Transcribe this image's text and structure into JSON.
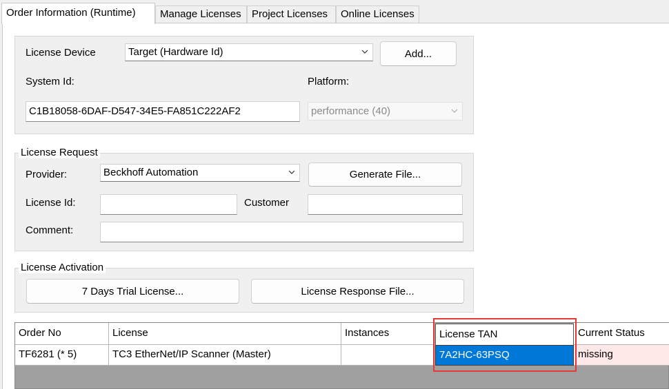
{
  "tabs": [
    {
      "label": "Order Information (Runtime)",
      "active": true
    },
    {
      "label": "Manage Licenses",
      "active": false
    },
    {
      "label": "Project Licenses",
      "active": false
    },
    {
      "label": "Online Licenses",
      "active": false
    }
  ],
  "license_device": {
    "label": "License Device",
    "selected": "Target (Hardware Id)",
    "add_button": "Add...",
    "system_id_label": "System Id:",
    "system_id_value": "C1B18058-6DAF-D547-34E5-FA851C222AF2",
    "platform_label": "Platform:",
    "platform_value": "performance (40)"
  },
  "license_request": {
    "legend": "License Request",
    "provider_label": "Provider:",
    "provider_value": "Beckhoff Automation",
    "generate_button": "Generate File...",
    "license_id_label": "License Id:",
    "license_id_value": "",
    "customer_label": "Customer",
    "customer_value": "",
    "comment_label": "Comment:",
    "comment_value": ""
  },
  "license_activation": {
    "legend": "License Activation",
    "trial_button": "7 Days Trial License...",
    "response_button": "License Response File..."
  },
  "table": {
    "columns": [
      "Order No",
      "License",
      "Instances",
      "License TAN",
      "Current Status"
    ],
    "rows": [
      {
        "order_no": "TF6281 (* 5)",
        "license": "TC3 EtherNet/IP Scanner (Master)",
        "instances": "",
        "license_tan": "7A2HC-63PSQ",
        "current_status": "missing"
      }
    ]
  },
  "colors": {
    "selection": "#0078d7",
    "missing_row": "#ffe8e8",
    "highlight_box": "#e53935"
  }
}
